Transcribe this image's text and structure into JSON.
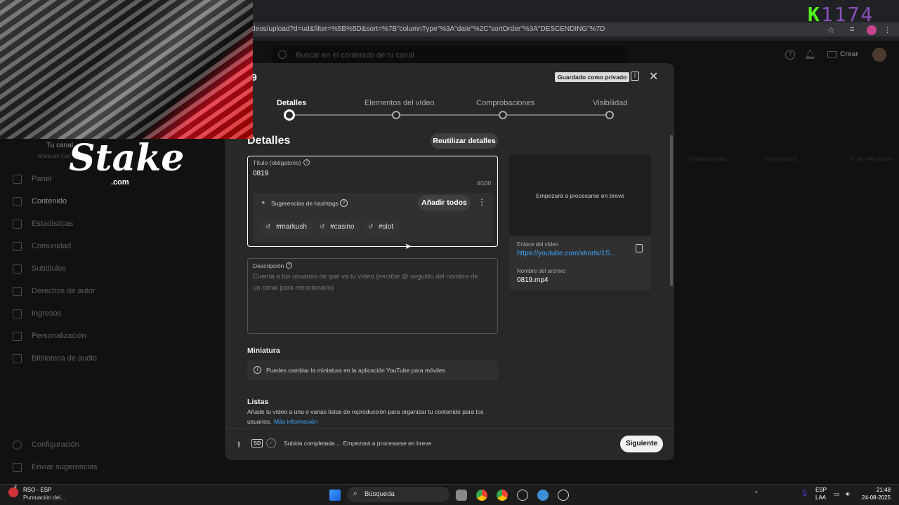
{
  "browser": {
    "url": "deos/upload?d=ud&filter=%5B%5D&sort=%7B\"columnType\"%3A\"date\"%2C\"sortOrder\"%3A\"DESCENDING\"%7D",
    "overlay_counter": "1174"
  },
  "studio": {
    "search_placeholder": "Buscar en el contenido de tu canal",
    "create_label": "Crear",
    "channel_label": "Tu canal",
    "channel_name": "Markush Gar",
    "col_views": "Visualizaciones",
    "col_comments": "Comentarios",
    "col_likes": "% de «Me gusta»",
    "nav": [
      {
        "label": "Panel",
        "icon": "dashboard-icon"
      },
      {
        "label": "Contenido",
        "icon": "content-icon"
      },
      {
        "label": "Estadísticas",
        "icon": "analytics-icon"
      },
      {
        "label": "Comunidad",
        "icon": "community-icon"
      },
      {
        "label": "Subtítulos",
        "icon": "subtitles-icon"
      },
      {
        "label": "Derechos de autor",
        "icon": "copyright-icon"
      },
      {
        "label": "Ingresos",
        "icon": "earn-icon"
      },
      {
        "label": "Personalización",
        "icon": "customization-icon"
      },
      {
        "label": "Biblioteca de audio",
        "icon": "audio-library-icon"
      }
    ],
    "settings_label": "Configuración",
    "feedback_label": "Enviar sugerencias"
  },
  "dialog": {
    "title": "9",
    "saved_badge": "Guardado como privado",
    "steps": [
      "Detalles",
      "Elementos del vídeo",
      "Comprobaciones",
      "Visibilidad"
    ],
    "section_title": "Detalles",
    "reuse_button": "Reutilizar detalles",
    "title_field_label": "Título (obligatorio)",
    "title_value": "0819",
    "title_counter": "4/100",
    "hashtag_label": "Sugerencias de hashtags",
    "add_all_button": "Añadir todos",
    "hashtags": [
      "#markush",
      "#casino",
      "#slot"
    ],
    "description_label": "Descripción",
    "description_placeholder_1": "Cuenta a los usuarios de qué va tu vídeo (escribe @ seguido del nombre de",
    "description_placeholder_2": "un canal para mencionarlo)",
    "thumbnail_title": "Miniatura",
    "thumbnail_info": "Puedes cambiar la miniatura en la aplicación YouTube para móviles",
    "lists_title": "Listas",
    "lists_desc_1": "Añade tu vídeo a una o varias listas de reproducción para organizar tu contenido para los",
    "lists_desc_2": "usuarios.",
    "lists_more": "Más información",
    "preview_text": "Empezará a procesarse en breve",
    "video_link_label": "Enlace del vídeo",
    "video_link": "https://youtube.com/shorts/1S...",
    "filename_label": "Nombre del archivo",
    "filename": "0819.mp4",
    "sd_badge": "SD",
    "footer_status": "Subida completada ... Empezará a procesarse en breve",
    "next_button": "Siguiente"
  },
  "stream_overlay": {
    "logo_text": "Stake",
    "logo_sub": ".com"
  },
  "taskbar": {
    "notif_title": "RSO - ESP",
    "notif_sub": "Puntuación del...",
    "notif_badge": "2",
    "search_label": "Búsqueda",
    "lang_1": "ESP",
    "lang_2": "LAA",
    "time": "21:48",
    "date": "24-08-2025"
  },
  "colors": {
    "accent_link": "#3ea6ff",
    "kick_green": "#53fc18"
  }
}
